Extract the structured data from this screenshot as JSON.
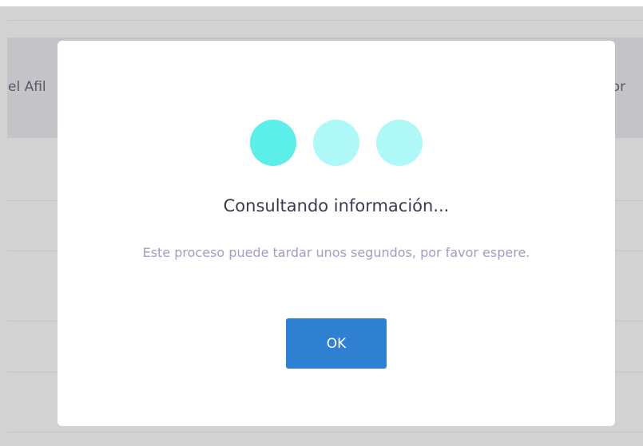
{
  "background": {
    "table_header_left": "el Afil",
    "table_header_right": "tor"
  },
  "modal": {
    "loader_icon": "loading-dots-icon",
    "title": "Consultando información...",
    "message": "Este proceso puede tardar unos segundos, por favor espere.",
    "ok_label": "OK"
  },
  "colors": {
    "overlay": "#d2d2d2",
    "dot_active": "#5ceee9",
    "dot_inactive": "#aef9f8",
    "button": "#2f80d0",
    "title_text": "#3a3b4e",
    "message_text": "#9b9fc3"
  }
}
